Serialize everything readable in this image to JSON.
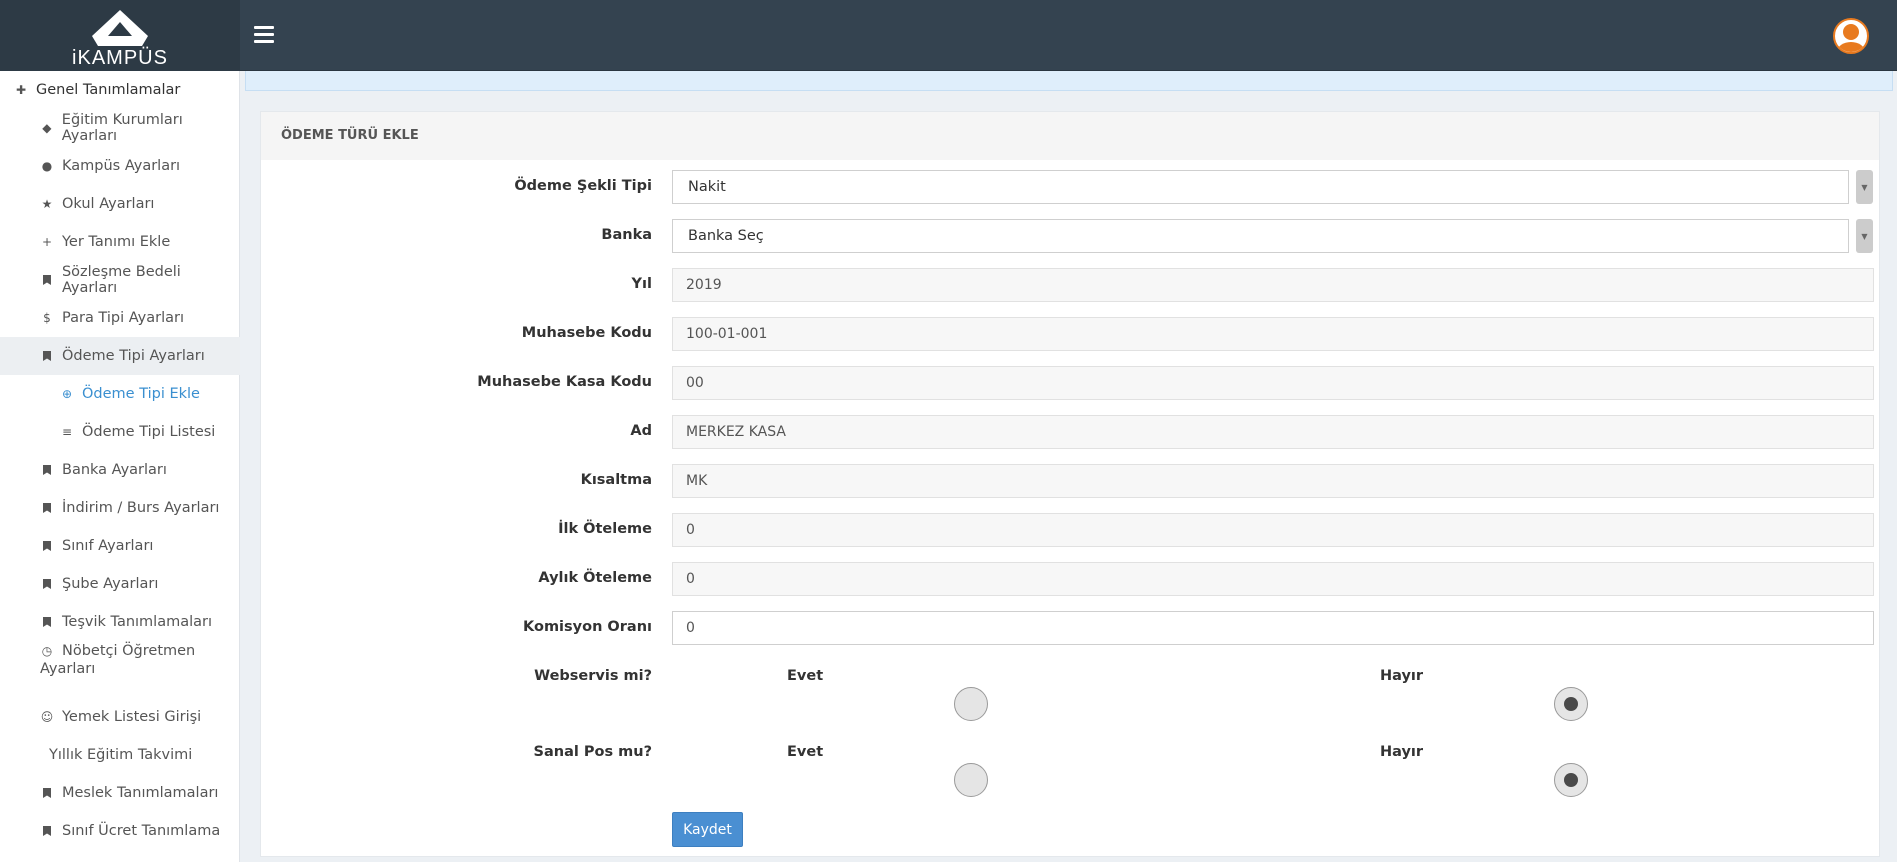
{
  "brand": {
    "logo_text": "iKAMPÜS"
  },
  "colors": {
    "topbar": "#344350",
    "accent": "#3a8fd0",
    "button": "#4a8fd2"
  },
  "sidebar": {
    "items": [
      {
        "label": "Genel Tanımlamalar",
        "icon": "puzzle-icon"
      },
      {
        "label": "Eğitim Kurumları Ayarları",
        "icon": "graduation-cap-icon"
      },
      {
        "label": "Kampüs Ayarları",
        "icon": "map-marker-icon"
      },
      {
        "label": "Okul Ayarları",
        "icon": "star-icon"
      },
      {
        "label": "Yer Tanımı Ekle",
        "icon": "plus-icon"
      },
      {
        "label": "Sözleşme Bedeli Ayarları",
        "icon": "bookmark-icon"
      },
      {
        "label": "Para Tipi Ayarları",
        "icon": "dollar-icon"
      },
      {
        "label": "Ödeme Tipi Ayarları",
        "icon": "bookmark-icon"
      },
      {
        "label": "Ödeme Tipi Ekle",
        "icon": "plus-circle-icon"
      },
      {
        "label": "Ödeme Tipi Listesi",
        "icon": "list-icon"
      },
      {
        "label": "Banka Ayarları",
        "icon": "bookmark-icon"
      },
      {
        "label": "İndirim / Burs Ayarları",
        "icon": "bookmark-icon"
      },
      {
        "label": "Sınıf Ayarları",
        "icon": "bookmark-icon"
      },
      {
        "label": "Şube Ayarları",
        "icon": "bookmark-icon"
      },
      {
        "label": "Teşvik Tanımlamaları",
        "icon": "bookmark-icon"
      },
      {
        "label_line1": "Nöbetçi Öğretmen",
        "label_line2": "Ayarları",
        "icon": "clock-icon"
      },
      {
        "label": "Yemek Listesi Girişi",
        "icon": "smile-icon"
      },
      {
        "label": "Yıllık Eğitim Takvimi",
        "icon": ""
      },
      {
        "label": "Meslek Tanımlamaları",
        "icon": "bookmark-icon"
      },
      {
        "label": "Sınıf Ücret Tanımlama",
        "icon": "bookmark-icon"
      }
    ]
  },
  "panel": {
    "title": "ÖDEME TÜRÜ EKLE",
    "fields": {
      "odeme_sekli": {
        "label": "Ödeme Şekli Tipi",
        "value": "Nakit"
      },
      "banka": {
        "label": "Banka",
        "value": "Banka Seç"
      },
      "yil": {
        "label": "Yıl",
        "value": "2019"
      },
      "muhasebe_kodu": {
        "label": "Muhasebe Kodu",
        "value": "100-01-001"
      },
      "kasa_kodu": {
        "label": "Muhasebe Kasa Kodu",
        "value": "00"
      },
      "ad": {
        "label": "Ad",
        "value": "MERKEZ KASA"
      },
      "kisaltma": {
        "label": "Kısaltma",
        "value": "MK"
      },
      "ilk_oteleme": {
        "label": "İlk Öteleme",
        "value": "0"
      },
      "aylik_oteleme": {
        "label": "Aylık Öteleme",
        "value": "0"
      },
      "komisyon": {
        "label": "Komisyon Oranı",
        "value": "0"
      }
    },
    "webservis": {
      "label": "Webservis mi?",
      "yes": "Evet",
      "no": "Hayır",
      "selected": "Hayır"
    },
    "sanalpos": {
      "label": "Sanal Pos mu?",
      "yes": "Evet",
      "no": "Hayır",
      "selected": "Hayır"
    },
    "save_label": "Kaydet"
  }
}
